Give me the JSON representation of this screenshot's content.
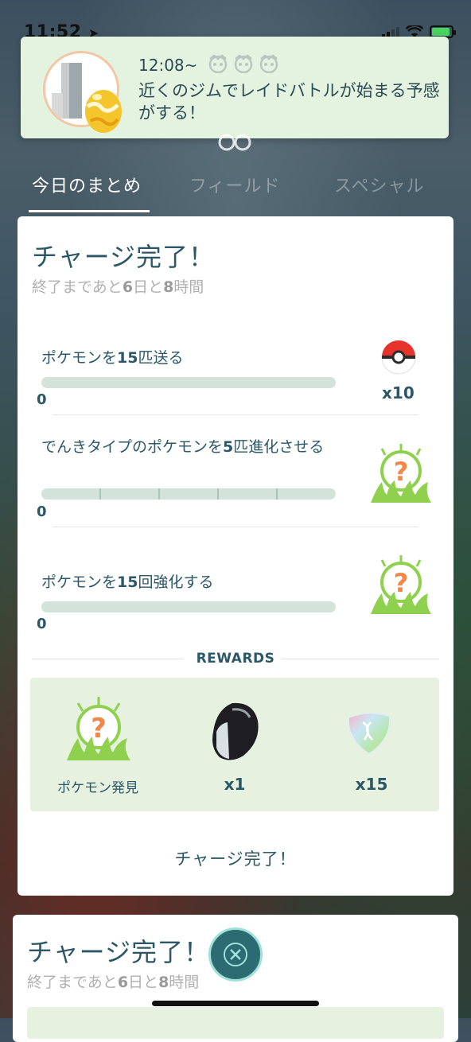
{
  "status_bar": {
    "time": "11:52",
    "battery_color": "#49d35f"
  },
  "notification": {
    "time": "12:08~",
    "text": "近くのジムでレイドバトルが始まる予感がする！"
  },
  "tabs": [
    {
      "label": "今日のまとめ",
      "active": true
    },
    {
      "label": "フィールド",
      "active": false
    },
    {
      "label": "スペシャル",
      "active": false
    }
  ],
  "card": {
    "title": "チャージ完了！",
    "subtitle_prefix": "終了まであと",
    "subtitle_days": "6",
    "subtitle_mid": "日と",
    "subtitle_hours": "8",
    "subtitle_suffix": "時間",
    "tasks": [
      {
        "pre": "ポケモンを",
        "num": "15",
        "post": "匹送る",
        "progress_count": "0",
        "progress": 0,
        "reward_type": "poke-ball",
        "reward_qty": "x10"
      },
      {
        "pre": "でんきタイプのポケモンを",
        "num": "5",
        "post": "匹進化させる",
        "progress_count": "0",
        "progress": 0,
        "reward_type": "mystery-encounter",
        "reward_qty": ""
      },
      {
        "pre": "ポケモンを",
        "num": "15",
        "post": "回強化する",
        "progress_count": "0",
        "progress": 0,
        "reward_type": "mystery-encounter",
        "reward_qty": ""
      }
    ],
    "rewards_title": "REWARDS",
    "rewards": [
      {
        "icon": "mystery-encounter",
        "label": "ポケモン発見"
      },
      {
        "icon": "sinnoh-stone",
        "qty": "x1"
      },
      {
        "icon": "rare-candy",
        "qty": "x15"
      }
    ],
    "footer_label": "チャージ完了！"
  },
  "card2": {
    "title": "チャージ完了！",
    "subtitle_prefix": "終了まであと",
    "subtitle_days": "6",
    "subtitle_mid": "日と",
    "subtitle_hours": "8",
    "subtitle_suffix": "時間"
  },
  "colors": {
    "accent_text": "#2b5766",
    "reward_bg": "#e6f2df",
    "close_button": "#2d6b73"
  }
}
